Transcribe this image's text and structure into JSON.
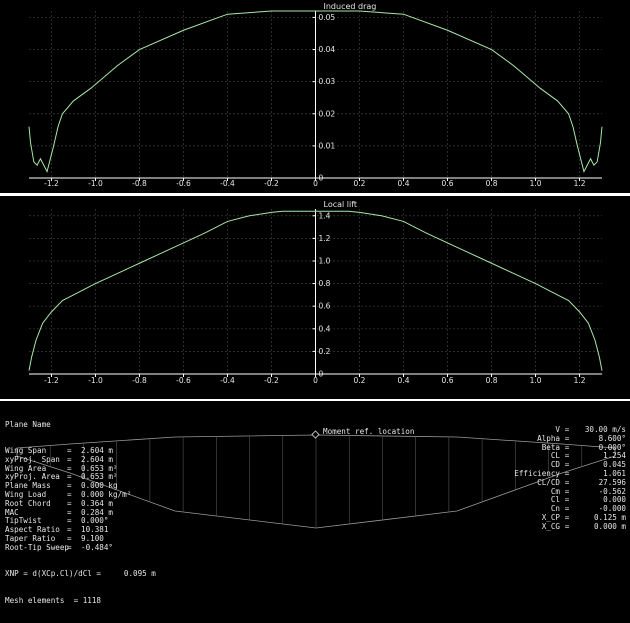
{
  "colors": {
    "curve": "#a8e6a8",
    "grid": "#3c3c3c",
    "axis": "#ffffff",
    "text": "#e6e6e6"
  },
  "chart_data": [
    {
      "type": "line",
      "title": "Induced drag",
      "xlabel": "",
      "ylabel": "",
      "xlim": [
        -1.302,
        1.302
      ],
      "ylim": [
        0,
        0.052
      ],
      "xticks": [
        "-1.2",
        "-1.0",
        "-0.8",
        "-0.6",
        "-0.4",
        "-0.2",
        "0",
        "0.2",
        "0.4",
        "0.6",
        "0.8",
        "1.0",
        "1.2"
      ],
      "yticks": [
        "0",
        "0.01",
        "0.02",
        "0.03",
        "0.04",
        "0.05"
      ],
      "grid": true,
      "series": [
        {
          "x": [
            -1.302,
            -1.295,
            -1.28,
            -1.265,
            -1.25,
            -1.235,
            -1.22,
            -1.205,
            -1.19,
            -1.17,
            -1.15,
            -1.1,
            -1.02,
            -0.9,
            -0.8,
            -0.6,
            -0.4,
            -0.2,
            0,
            0.2,
            0.4,
            0.6,
            0.8,
            0.9,
            1.02,
            1.1,
            1.15,
            1.17,
            1.19,
            1.205,
            1.22,
            1.235,
            1.25,
            1.265,
            1.28,
            1.295,
            1.302
          ],
          "y": [
            0.016,
            0.011,
            0.005,
            0.004,
            0.006,
            0.004,
            0.002,
            0.006,
            0.01,
            0.016,
            0.02,
            0.024,
            0.028,
            0.035,
            0.04,
            0.046,
            0.051,
            0.052,
            0.052,
            0.052,
            0.051,
            0.046,
            0.04,
            0.035,
            0.028,
            0.024,
            0.02,
            0.016,
            0.01,
            0.006,
            0.002,
            0.004,
            0.006,
            0.004,
            0.005,
            0.011,
            0.016
          ]
        }
      ]
    },
    {
      "type": "line",
      "title": "Local lift",
      "xlabel": "",
      "ylabel": "",
      "xlim": [
        -1.302,
        1.302
      ],
      "ylim": [
        0,
        1.46
      ],
      "xticks": [
        "-1.2",
        "-1.0",
        "-0.8",
        "-0.6",
        "-0.4",
        "-0.2",
        "0",
        "0.2",
        "0.4",
        "0.6",
        "0.8",
        "1.0",
        "1.2"
      ],
      "yticks": [
        "0",
        "0.2",
        "0.4",
        "0.6",
        "0.8",
        "1.0",
        "1.2",
        "1.4"
      ],
      "grid": true,
      "series": [
        {
          "x": [
            -1.302,
            -1.29,
            -1.27,
            -1.24,
            -1.2,
            -1.15,
            -1.1,
            -1.0,
            -0.9,
            -0.8,
            -0.7,
            -0.6,
            -0.5,
            -0.4,
            -0.3,
            -0.2,
            -0.15,
            0,
            0.15,
            0.2,
            0.3,
            0.4,
            0.5,
            0.6,
            0.7,
            0.8,
            0.9,
            1.0,
            1.1,
            1.15,
            1.2,
            1.24,
            1.27,
            1.29,
            1.302
          ],
          "y": [
            0.03,
            0.15,
            0.3,
            0.45,
            0.55,
            0.65,
            0.7,
            0.8,
            0.89,
            0.98,
            1.07,
            1.16,
            1.25,
            1.35,
            1.4,
            1.43,
            1.44,
            1.44,
            1.44,
            1.43,
            1.4,
            1.35,
            1.25,
            1.16,
            1.07,
            0.98,
            0.89,
            0.8,
            0.7,
            0.65,
            0.55,
            0.45,
            0.3,
            0.15,
            0.03
          ]
        }
      ]
    }
  ],
  "plane": {
    "name_label": "Plane Name",
    "left_props": [
      {
        "label": "Wing Span",
        "value": "2.604 m"
      },
      {
        "label": "xyProj. Span",
        "value": "2.604 m"
      },
      {
        "label": "Wing Area",
        "value": "0.653 m²"
      },
      {
        "label": "xyProj. Area",
        "value": "0.653 m²"
      },
      {
        "label": "Plane Mass",
        "value": "0.000 kg"
      },
      {
        "label": "Wing Load",
        "value": "0.000 kg/m²"
      },
      {
        "label": "Root Chord",
        "value": "0.364 m"
      },
      {
        "label": "MAC",
        "value": "0.284 m"
      },
      {
        "label": "TipTwist",
        "value": "0.000°"
      },
      {
        "label": "Aspect Ratio",
        "value": "10.381"
      },
      {
        "label": "Taper Ratio",
        "value": "9.100"
      },
      {
        "label": "Root-Tip Sweep",
        "value": "-0.484°"
      }
    ],
    "xnp_line": "XNP = d(XCp.Cl)/dCl =     0.095 m",
    "mesh_line": "Mesh elements  = 1118",
    "moment_label": "Moment ref. location",
    "right_props": [
      {
        "label": "V",
        "value": "30.00 m/s"
      },
      {
        "label": "Alpha",
        "value": "8.600°"
      },
      {
        "label": "Beta",
        "value": "0.000°"
      },
      {
        "label": "CL",
        "value": "1.254"
      },
      {
        "label": "CD",
        "value": "0.045"
      },
      {
        "label": "Efficiency",
        "value": "1.061"
      },
      {
        "label": "CL/CD",
        "value": "27.596"
      },
      {
        "label": "Cm",
        "value": "-0.562"
      },
      {
        "label": "Cl",
        "value": "0.000"
      },
      {
        "label": "Cn",
        "value": "-0.000"
      },
      {
        "label": "X_CP",
        "value": "0.125 m"
      },
      {
        "label": "X_CG",
        "value": "0.000 m"
      }
    ]
  }
}
